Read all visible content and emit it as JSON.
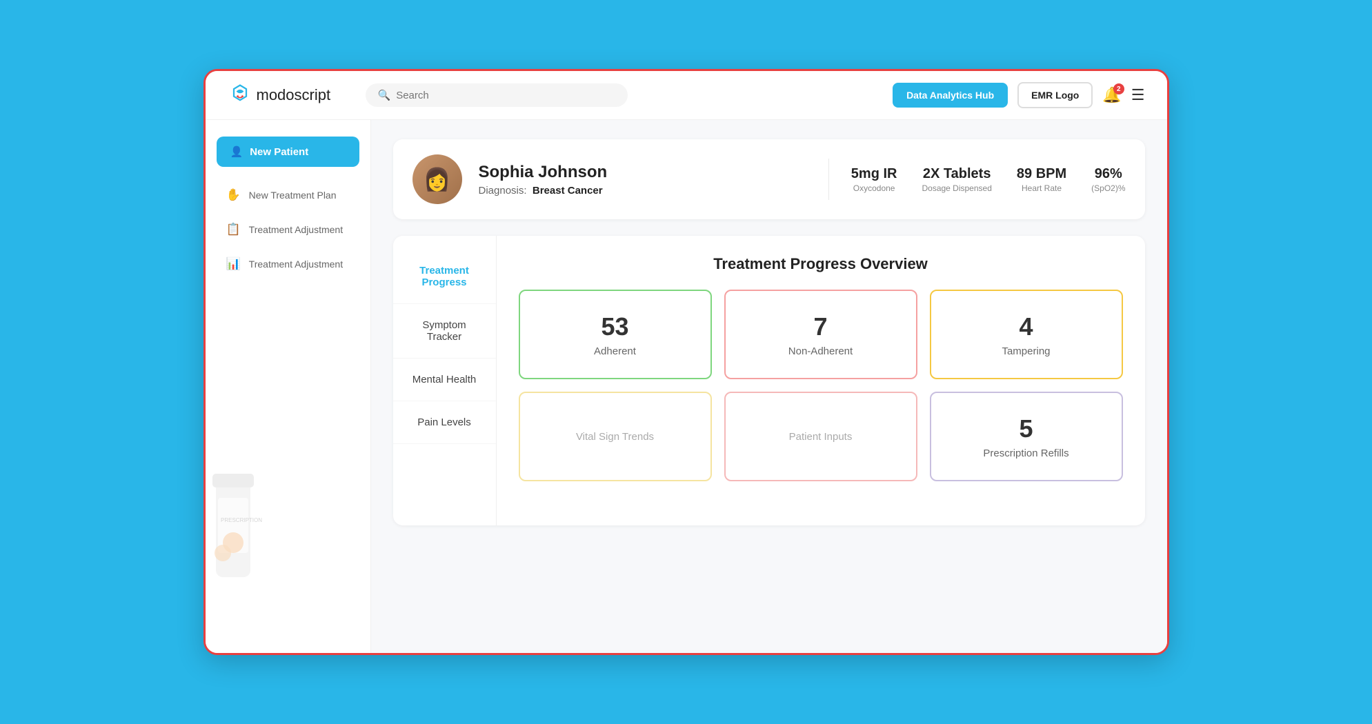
{
  "logo": {
    "brand": "modo",
    "brand2": "script"
  },
  "header": {
    "search_placeholder": "Search",
    "analytics_btn": "Data Analytics Hub",
    "emr_btn": "EMR Logo",
    "notif_count": "2"
  },
  "sidebar": {
    "new_patient_btn": "New Patient",
    "items": [
      {
        "label": "New Treatment Plan",
        "icon": "✋"
      },
      {
        "label": "Treatment Adjustment",
        "icon": "📋"
      },
      {
        "label": "Treatment Adjustment",
        "icon": "📊"
      }
    ]
  },
  "patient": {
    "name": "Sophia Johnson",
    "diagnosis_label": "Diagnosis:",
    "diagnosis": "Breast Cancer",
    "vitals": [
      {
        "value": "5mg IR",
        "label": "Oxycodone"
      },
      {
        "value": "2X Tablets",
        "label": "Dosage Dispensed"
      },
      {
        "value": "89 BPM",
        "label": "Heart Rate"
      },
      {
        "value": "96%",
        "label": "(SpO2)%"
      }
    ]
  },
  "treatment": {
    "nav_items": [
      {
        "label": "Treatment Progress",
        "active": true
      },
      {
        "label": "Symptom Tracker",
        "active": false
      },
      {
        "label": "Mental Health",
        "active": false
      },
      {
        "label": "Pain Levels",
        "active": false
      }
    ],
    "overview_title": "Treatment  Progress Overview",
    "metrics": [
      {
        "value": "53",
        "label": "Adherent",
        "border": "green"
      },
      {
        "value": "7",
        "label": "Non-Adherent",
        "border": "red"
      },
      {
        "value": "4",
        "label": "Tampering",
        "border": "yellow"
      },
      {
        "value": "",
        "label": "Vital Sign Trends",
        "border": "light-yellow",
        "muted": true
      },
      {
        "value": "",
        "label": "Patient Inputs",
        "border": "light-red",
        "muted": true
      },
      {
        "value": "5",
        "label": "Prescription Refills",
        "border": "light-purple"
      }
    ]
  }
}
